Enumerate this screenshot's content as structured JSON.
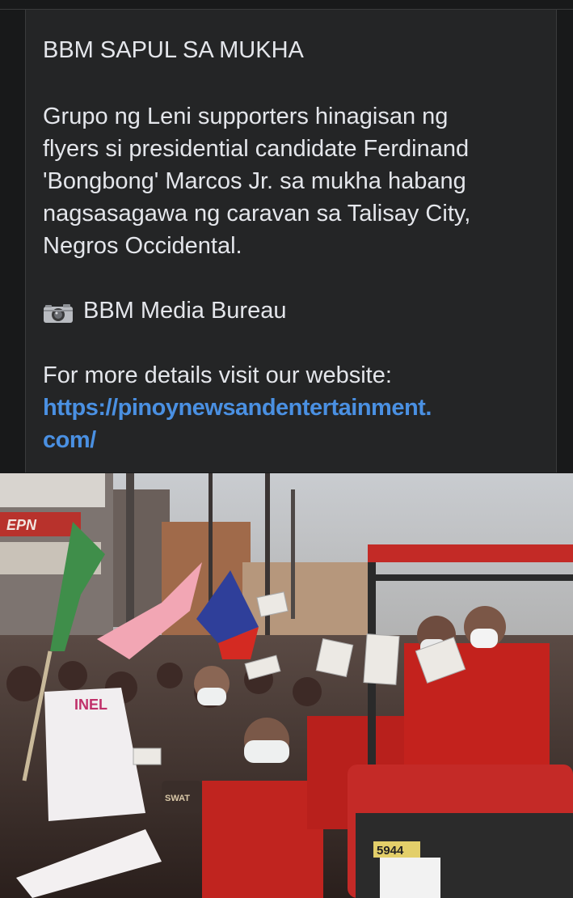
{
  "post": {
    "headline": "BBM SAPUL SA MUKHA",
    "body_line_1": "Grupo ng Leni supporters hinagisan ng",
    "body_line_2": "flyers si presidential candidate Ferdinand",
    "body_line_3": "'Bongbong' Marcos Jr. sa mukha habang",
    "body_line_4": "nagsasagawa ng caravan sa Talisay City,",
    "body_line_5": "Negros Occidental.",
    "credit_icon": "camera-icon",
    "credit": "BBM Media Bureau",
    "details_text": "For more details visit our website:",
    "link_line_1": "https://pinoynewsandentertainment.",
    "link_line_2": "com/"
  },
  "photo": {
    "sign_text": "EPN",
    "banner_text": "INEL",
    "plate_text": "5944",
    "cap_text": "SWAT"
  },
  "colors": {
    "background": "#18191a",
    "card": "#242526",
    "text": "#e4e6eb",
    "link": "#4a90e2"
  }
}
